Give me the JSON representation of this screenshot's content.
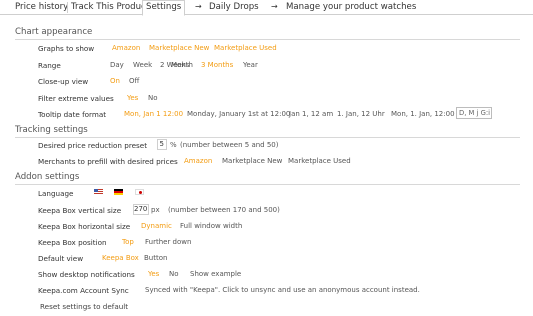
{
  "tabs": {
    "price_history": "Price history",
    "track_product": "Track This Product",
    "settings": "Settings",
    "daily_drops": "Daily Drops",
    "manage_watches": "Manage your product watches",
    "arrow": "→"
  },
  "sections": {
    "chart_appearance": "Chart appearance",
    "tracking_settings": "Tracking settings",
    "addon_settings": "Addon settings"
  },
  "chart": {
    "graphs": {
      "label": "Graphs to show",
      "options": [
        "Amazon",
        "Marketplace New",
        "Marketplace Used"
      ]
    },
    "range": {
      "label": "Range",
      "options": [
        "Day",
        "Week",
        "2 Weeks",
        "Month",
        "3 Months",
        "Year"
      ],
      "selected": "3 Months"
    },
    "closeup": {
      "label": "Close-up view",
      "options": [
        "On",
        "Off"
      ],
      "selected": "On"
    },
    "filter": {
      "label": "Filter extreme values",
      "options": [
        "Yes",
        "No"
      ],
      "selected": "Yes"
    },
    "tooltip": {
      "label": "Tooltip date format",
      "options": [
        "Mon, Jan 1 12:00",
        "Monday, January 1st at 12:00",
        "Jan 1, 12 am",
        "1. Jan, 12 Uhr",
        "Mon, 1. Jan, 12:00"
      ],
      "selected": "Mon, Jan 1 12:00",
      "custom_value": "D, M j G:i"
    }
  },
  "tracking": {
    "reduction": {
      "label": "Desired price reduction preset",
      "value": "5",
      "unit": "%",
      "note": "(number between 5 and 50)"
    },
    "merchants": {
      "label": "Merchants to prefill with desired prices",
      "options": [
        "Amazon",
        "Marketplace New",
        "Marketplace Used"
      ],
      "selected": "Amazon"
    }
  },
  "addon": {
    "language": {
      "label": "Language",
      "flags": [
        "us-flag-icon",
        "de-flag-icon",
        "jp-flag-icon"
      ]
    },
    "vertical": {
      "label": "Keepa Box vertical size",
      "value": "270",
      "unit": "px",
      "note": "(number between 170 and 500)"
    },
    "horizontal": {
      "label": "Keepa Box horizontal size",
      "options": [
        "Dynamic",
        "Full window width"
      ],
      "selected": "Dynamic"
    },
    "position": {
      "label": "Keepa Box position",
      "options": [
        "Top",
        "Further down"
      ],
      "selected": "Top"
    },
    "default_view": {
      "label": "Default view",
      "options": [
        "Keepa Box",
        "Button"
      ],
      "selected": "Keepa Box"
    },
    "notifications": {
      "label": "Show desktop notifications",
      "options": [
        "Yes",
        "No",
        "Show example"
      ],
      "selected": "Yes"
    },
    "account_sync": {
      "label": "Keepa.com Account Sync",
      "text": "Synced with \"Keepa\". Click to unsync and use an anonymous account instead."
    }
  },
  "reset_label": "Reset settings to default",
  "colors": {
    "accent": "#f39c12",
    "rule": "#d8d8d8",
    "text": "#333333"
  }
}
